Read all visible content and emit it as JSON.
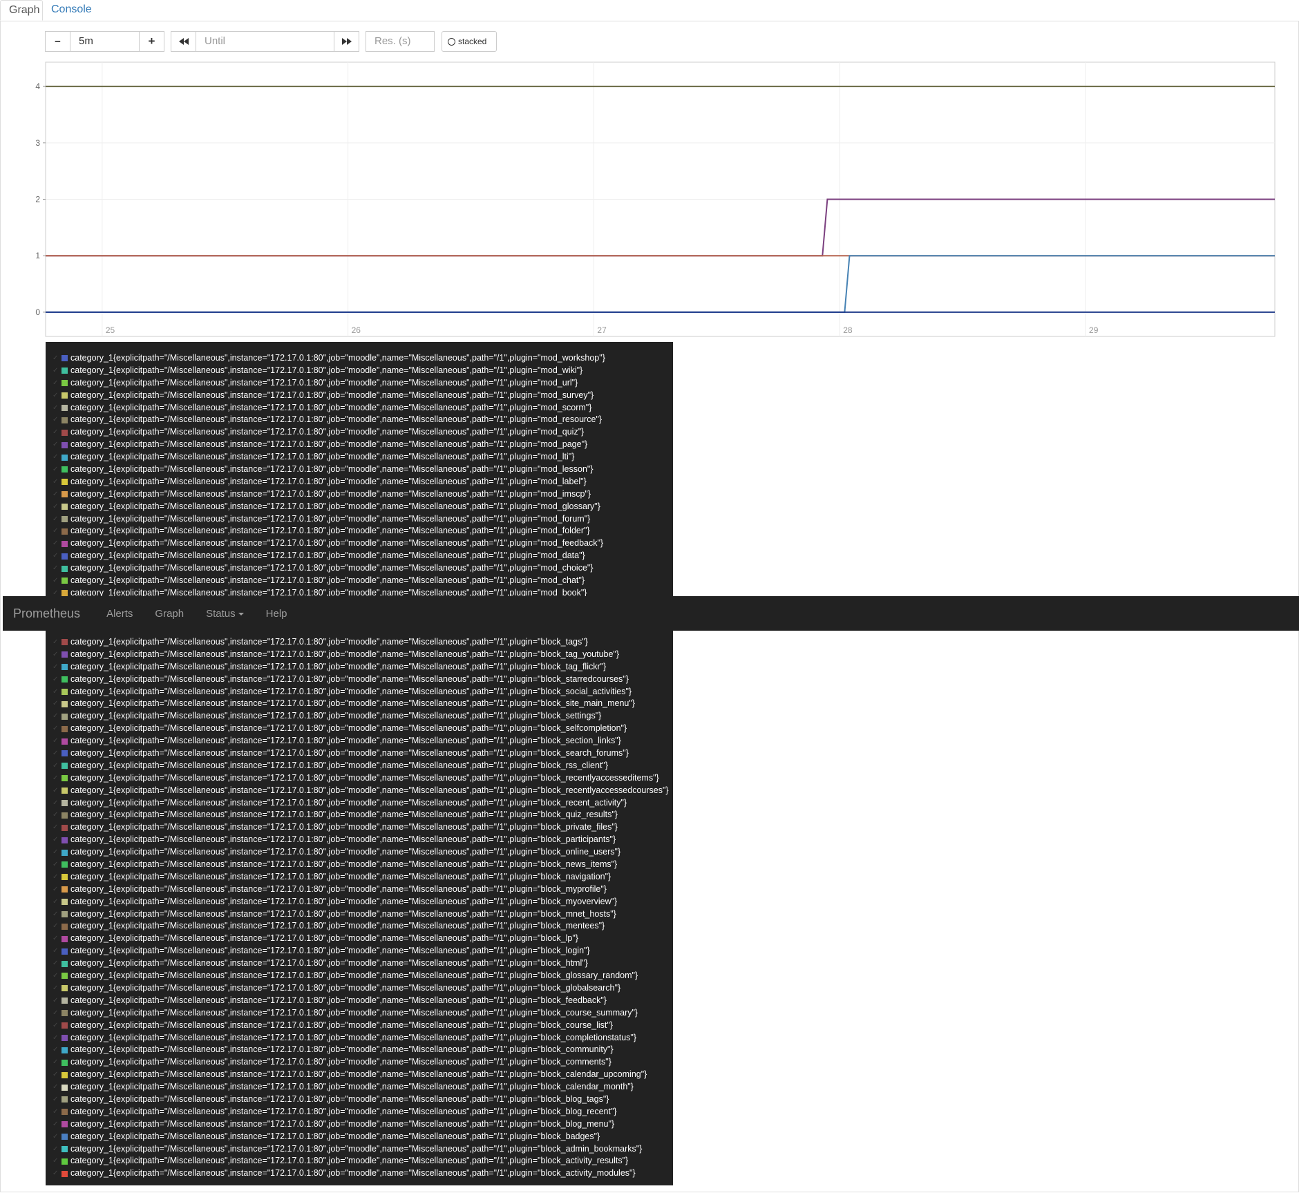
{
  "tabs": [
    {
      "label": "Graph"
    },
    {
      "label": "Console"
    }
  ],
  "controls": {
    "minus": "−",
    "range": "5m",
    "plus": "+",
    "until_placeholder": "Until",
    "res_placeholder": "Res. (s)",
    "stacked_label": "stacked"
  },
  "navbar": {
    "brand": "Prometheus",
    "items": [
      "Alerts",
      "Graph",
      "Status",
      "Help"
    ]
  },
  "chart_data": {
    "type": "line",
    "x_ticks": [
      "25",
      "26",
      "27",
      "28",
      "29"
    ],
    "y_ticks": [
      "0",
      "1",
      "2",
      "3",
      "4"
    ],
    "xlim": [
      24.77,
      29.77
    ],
    "ylim": [
      -0.43,
      4.43
    ],
    "series": [
      {
        "color": "#6a6a45",
        "points": [
          [
            24.77,
            4
          ],
          [
            29.77,
            4
          ]
        ]
      },
      {
        "color": "#7b3f7f",
        "points": [
          [
            24.77,
            1
          ],
          [
            27.93,
            1
          ],
          [
            27.95,
            2
          ],
          [
            29.77,
            2
          ]
        ]
      },
      {
        "color": "#b5634e",
        "points": [
          [
            24.77,
            1
          ],
          [
            29.77,
            1
          ]
        ]
      },
      {
        "color": "#4682b4",
        "points": [
          [
            24.77,
            0
          ],
          [
            28.02,
            0
          ],
          [
            28.04,
            1
          ],
          [
            29.77,
            1
          ]
        ]
      },
      {
        "color": "#1f3a8a",
        "points": [
          [
            24.77,
            0
          ],
          [
            29.77,
            0
          ]
        ]
      }
    ]
  },
  "legend_prefix": "category_1{explicitpath=\"/Miscellaneous\",instance=\"172.17.0.1:80\",job=\"moodle\",name=\"Miscellaneous\",path=\"/1\",plugin=\"",
  "legend_suffix": "\"}",
  "legend_top": [
    {
      "p": "mod_workshop",
      "c": "#4a5fc1"
    },
    {
      "p": "mod_wiki",
      "c": "#3fbf9f"
    },
    {
      "p": "mod_url",
      "c": "#7ac943"
    },
    {
      "p": "mod_survey",
      "c": "#c8c86a"
    },
    {
      "p": "mod_scorm",
      "c": "#b4b4a0"
    },
    {
      "p": "mod_resource",
      "c": "#8c8464"
    },
    {
      "p": "mod_quiz",
      "c": "#a04a4a"
    },
    {
      "p": "mod_page",
      "c": "#7f4fb0"
    },
    {
      "p": "mod_lti",
      "c": "#3fa8c8"
    },
    {
      "p": "mod_lesson",
      "c": "#3fbf5f"
    },
    {
      "p": "mod_label",
      "c": "#d8c83a"
    },
    {
      "p": "mod_imscp",
      "c": "#d89a4a"
    },
    {
      "p": "mod_glossary",
      "c": "#c8c88a"
    },
    {
      "p": "mod_forum",
      "c": "#a0a080"
    },
    {
      "p": "mod_folder",
      "c": "#8c6a4a"
    },
    {
      "p": "mod_feedback",
      "c": "#b04aa0"
    },
    {
      "p": "mod_data",
      "c": "#4a5fc1"
    },
    {
      "p": "mod_choice",
      "c": "#3fbf9f"
    },
    {
      "p": "mod_chat",
      "c": "#7ac943"
    },
    {
      "p": "mod_book",
      "c": "#d8a83a"
    }
  ],
  "legend_bottom": [
    {
      "p": "block_tags",
      "c": "#a04a4a"
    },
    {
      "p": "block_tag_youtube",
      "c": "#7f4fb0"
    },
    {
      "p": "block_tag_flickr",
      "c": "#3fa8c8"
    },
    {
      "p": "block_starredcourses",
      "c": "#3fbf5f"
    },
    {
      "p": "block_social_activities",
      "c": "#a8c85a"
    },
    {
      "p": "block_site_main_menu",
      "c": "#c8c88a"
    },
    {
      "p": "block_settings",
      "c": "#a0a080"
    },
    {
      "p": "block_selfcompletion",
      "c": "#8c6a4a"
    },
    {
      "p": "block_section_links",
      "c": "#b04aa0"
    },
    {
      "p": "block_search_forums",
      "c": "#4a5fc1"
    },
    {
      "p": "block_rss_client",
      "c": "#3fbf9f"
    },
    {
      "p": "block_recentlyaccesseditems",
      "c": "#7ac943"
    },
    {
      "p": "block_recentlyaccessedcourses",
      "c": "#c8c86a"
    },
    {
      "p": "block_recent_activity",
      "c": "#b4b4a0"
    },
    {
      "p": "block_quiz_results",
      "c": "#8c8464"
    },
    {
      "p": "block_private_files",
      "c": "#a04a4a"
    },
    {
      "p": "block_participants",
      "c": "#7f4fb0"
    },
    {
      "p": "block_online_users",
      "c": "#3fa8c8"
    },
    {
      "p": "block_news_items",
      "c": "#3fbf5f"
    },
    {
      "p": "block_navigation",
      "c": "#d8c83a"
    },
    {
      "p": "block_myprofile",
      "c": "#d89a4a"
    },
    {
      "p": "block_myoverview",
      "c": "#c8c88a"
    },
    {
      "p": "block_mnet_hosts",
      "c": "#a0a080"
    },
    {
      "p": "block_mentees",
      "c": "#8c6a4a"
    },
    {
      "p": "block_lp",
      "c": "#b04aa0"
    },
    {
      "p": "block_login",
      "c": "#4a5fc1"
    },
    {
      "p": "block_html",
      "c": "#3fbf9f"
    },
    {
      "p": "block_glossary_random",
      "c": "#7ac943"
    },
    {
      "p": "block_globalsearch",
      "c": "#c8c86a"
    },
    {
      "p": "block_feedback",
      "c": "#b4b4a0"
    },
    {
      "p": "block_course_summary",
      "c": "#8c8464"
    },
    {
      "p": "block_course_list",
      "c": "#a04a4a"
    },
    {
      "p": "block_completionstatus",
      "c": "#7f4fb0"
    },
    {
      "p": "block_community",
      "c": "#3fa8c8"
    },
    {
      "p": "block_comments",
      "c": "#3fbf5f"
    },
    {
      "p": "block_calendar_upcoming",
      "c": "#d8c83a"
    },
    {
      "p": "block_calendar_month",
      "c": "#d8d8c0"
    },
    {
      "p": "block_blog_tags",
      "c": "#a0a080"
    },
    {
      "p": "block_blog_recent",
      "c": "#8c6a4a"
    },
    {
      "p": "block_blog_menu",
      "c": "#b04aa0"
    },
    {
      "p": "block_badges",
      "c": "#4a7fc1"
    },
    {
      "p": "block_admin_bookmarks",
      "c": "#3fbfbf"
    },
    {
      "p": "block_activity_results",
      "c": "#5fc93f"
    },
    {
      "p": "block_activity_modules",
      "c": "#e04a3a"
    }
  ]
}
